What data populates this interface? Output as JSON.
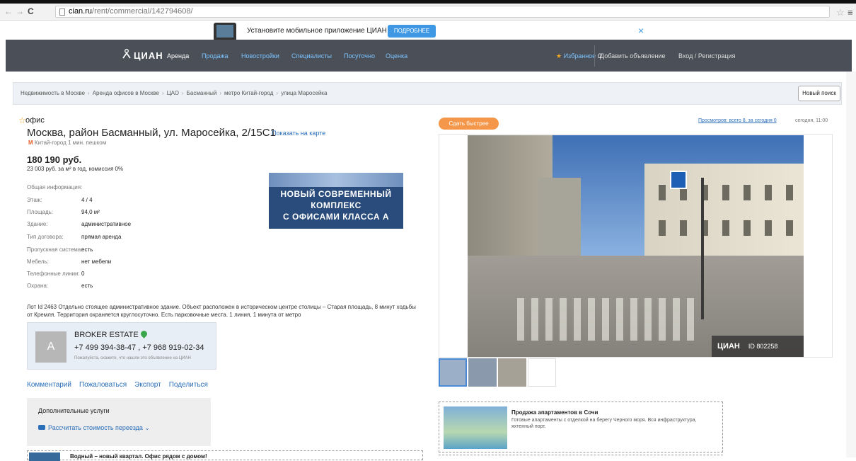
{
  "browser": {
    "url_host": "cian.ru",
    "url_path": "/rent/commercial/142794608/"
  },
  "promo": {
    "text": "Установите мобильное приложение ЦИАН",
    "button": "ПОДРОБНЕЕ",
    "close": "×"
  },
  "header": {
    "logo": "ЦИАН",
    "nav": [
      "Аренда",
      "Продажа",
      "Новостройки",
      "Специалисты",
      "Посуточно",
      "Оценка"
    ],
    "favorites_label": "Избранное",
    "favorites_count": "0",
    "add_listing": "Добавить объявление",
    "login": "Вход / Регистрация"
  },
  "breadcrumbs": [
    "Недвижимость в Москве",
    "Аренда офисов в Москве",
    "ЦАО",
    "Басманный",
    "метро Китай-город",
    "улица Маросейка"
  ],
  "new_search": "Новый поиск",
  "listing": {
    "type": "офис",
    "address": "Москва, район Басманный, ул. Маросейка, 2/15С1",
    "map_link": "Показать на карте",
    "metro_icon": "М",
    "metro": "Китай-город 1 мин. пешком",
    "price": "180 190 руб.",
    "price_sub": "23 003 руб. за м² в год, комиссия 0%",
    "info": [
      {
        "k": "Общая информация:",
        "v": ""
      },
      {
        "k": "Этаж:",
        "v": "4 / 4"
      },
      {
        "k": "Площадь:",
        "v": "94,0 м²"
      },
      {
        "k": "Здание:",
        "v": "административное"
      },
      {
        "k": "Тип договора:",
        "v": "прямая аренда"
      },
      {
        "k": "Пропускная система:",
        "v": "есть"
      },
      {
        "k": "Мебель:",
        "v": "нет мебели"
      },
      {
        "k": "Телефонные линии:",
        "v": "0"
      },
      {
        "k": "Охрана:",
        "v": "есть"
      }
    ],
    "description": "Лот Id 2463 Отдельно стоящее административное здание. Объект расположен в историческом центре столицы – Старая площадь, 8 минут ходьбы от Кремля. Территория охраняется круглосуточно. Есть парковочные места. 1 линия, 1 минута от метро"
  },
  "banner": {
    "line1": "НОВЫЙ СОВРЕМЕННЫЙ",
    "line2": "КОМПЛЕКС",
    "line3": "С ОФИСАМИ КЛАССА А"
  },
  "broker": {
    "avatar_letter": "А",
    "name": "BROKER ESTATE",
    "phones": "+7 499 394-38-47 , +7 968 919-02-34",
    "note": "Пожалуйста, скажите, что нашли это объявление на ЦИАН"
  },
  "actions": [
    "Комментарий",
    "Пожаловаться",
    "Экспорт",
    "Поделиться"
  ],
  "extra_services": {
    "title": "Дополнительные услуги",
    "link": "Рассчитать стоимость переезда ⌄"
  },
  "bottom_ad": "Водный – новый квартал. Офис рядом с домом!",
  "right": {
    "faster": "Сдать быстрее",
    "views": "Просмотров: всего 8, за сегодня 0",
    "time": "сегодня, 11:00",
    "watermark_logo": "ЦИАН",
    "watermark_id": "ID 802258"
  },
  "ad2": {
    "title": "Продажа апартаментов в Сочи",
    "desc": "Готовые апартаменты с отделкой на берегу Черного моря. Вся инфраструктура, яхтенный порт."
  },
  "colors": {
    "header_bg": "#4a4f58",
    "link": "#2c6fb9",
    "accent_orange": "#f4974a",
    "promo_button": "#3e98e3"
  }
}
